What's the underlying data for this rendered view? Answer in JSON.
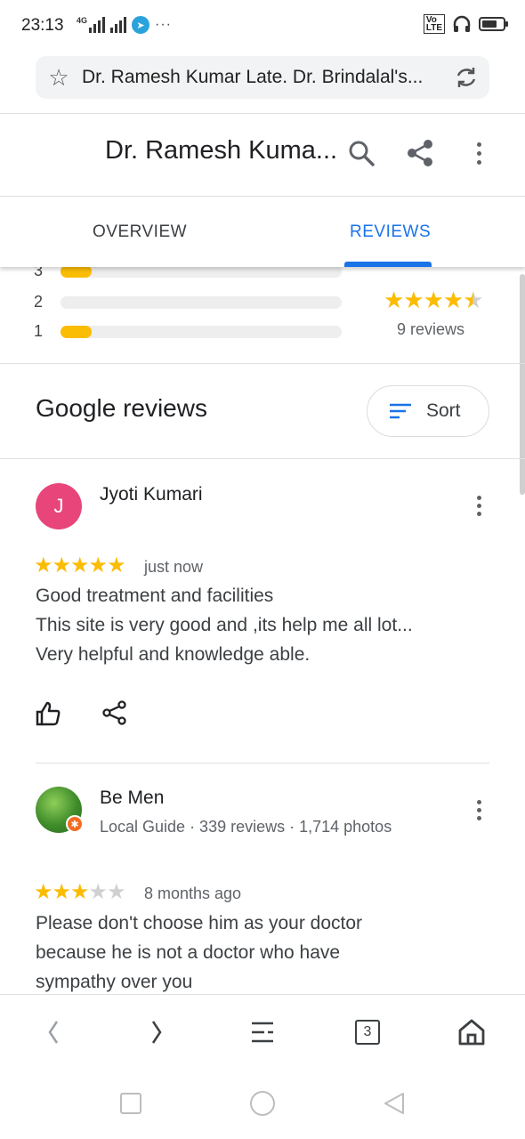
{
  "status": {
    "time": "23:13",
    "network": "4G",
    "volte": "VoLTE"
  },
  "urlbar": {
    "url": "Dr. Ramesh Kumar Late. Dr. Brindalal's..."
  },
  "header": {
    "title": "Dr. Ramesh Kuma..."
  },
  "tabs": [
    {
      "label": "OVERVIEW",
      "active": false
    },
    {
      "label": "REVIEWS",
      "active": true
    }
  ],
  "rating_summary": {
    "rows": [
      {
        "stars": "3",
        "fraction": 0.11
      },
      {
        "stars": "2",
        "fraction": 0.0
      },
      {
        "stars": "1",
        "fraction": 0.11
      }
    ],
    "average_stars": 4.5,
    "review_count": "9 reviews"
  },
  "google_reviews": {
    "title": "Google reviews",
    "sort_label": "Sort"
  },
  "reviews": [
    {
      "initial": "J",
      "name": "Jyoti Kumari",
      "avatar_color": "#e8457a",
      "rating": 5,
      "time": "just now",
      "lines": [
        "Good treatment and facilities",
        "This site is very good and ,its help me all lot...",
        "Very helpful and knowledge able."
      ]
    },
    {
      "name": "Be Men",
      "meta": "Local Guide · 339 reviews · 1,714 photos",
      "rating": 3,
      "time": "8 months ago",
      "lines": [
        "Please don't choose him as your doctor",
        "because he is not a doctor who have",
        "sympathy over you"
      ]
    }
  ],
  "bottombar": {
    "tab_count": "3"
  },
  "colors": {
    "accent": "#1a73e8",
    "star": "#fbbc04"
  }
}
